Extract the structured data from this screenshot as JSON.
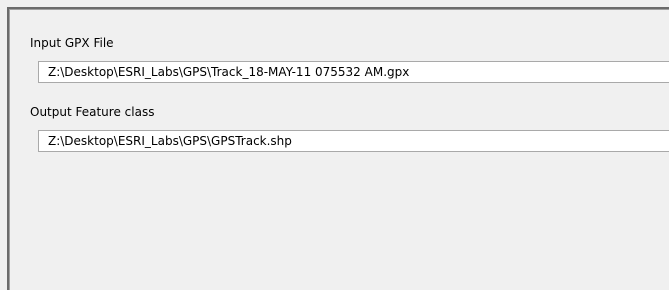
{
  "form": {
    "input_gpx": {
      "label": "Input GPX File",
      "value": "Z:\\Desktop\\ESRI_Labs\\GPS\\Track_18-MAY-11 075532 AM.gpx"
    },
    "output_feature_class": {
      "label": "Output Feature class",
      "value": "Z:\\Desktop\\ESRI_Labs\\GPS\\GPSTrack.shp"
    }
  },
  "colors": {
    "dialog_background": "#f0f0f0",
    "input_background": "#ffffff",
    "frame_dark": "#6b6b6b"
  }
}
